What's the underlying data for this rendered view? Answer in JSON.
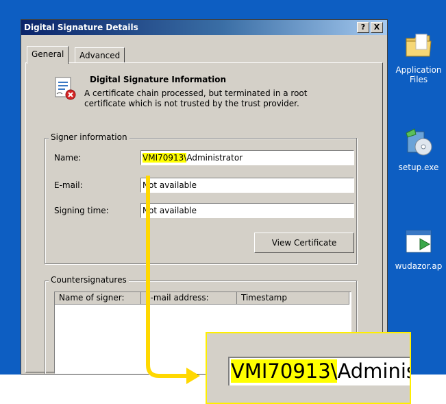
{
  "desktop": {
    "icons": [
      {
        "icon": "folder-icon",
        "label": "Application Files"
      },
      {
        "icon": "installer-icon",
        "label": "setup.exe"
      },
      {
        "icon": "application-icon",
        "label": "wudazor.ap"
      }
    ]
  },
  "dialog": {
    "title": "Digital Signature Details",
    "help_button": "?",
    "close_button": "X",
    "tabs": [
      {
        "label": "General",
        "active": true
      },
      {
        "label": "Advanced",
        "active": false
      }
    ],
    "info": {
      "icon": "certificate-error-icon",
      "title": "Digital Signature Information",
      "message": "A certificate chain processed, but terminated in a root certificate which is not trusted by the trust provider."
    },
    "signer": {
      "group_label": "Signer information",
      "name_label": "Name:",
      "name_highlight": "VMI70913\\",
      "name_rest": "Administrator",
      "email_label": "E-mail:",
      "email_value": "Not available",
      "signing_time_label": "Signing time:",
      "signing_time_value": "Not available",
      "view_certificate_button": "View Certificate"
    },
    "countersignatures": {
      "group_label": "Countersignatures",
      "columns": [
        "Name of signer:",
        "E-mail address:",
        "Timestamp"
      ]
    }
  },
  "zoom_callout": {
    "highlight": "VMI70913\\",
    "rest": "Adminis"
  },
  "colors": {
    "highlight": "#ffff00",
    "callout_border": "#ffef00",
    "desktop": "#0d5ec2"
  }
}
